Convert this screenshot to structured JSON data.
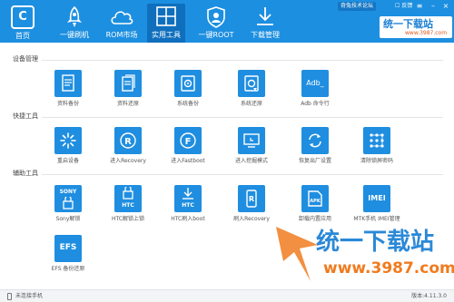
{
  "colors": {
    "topbar": "#1d8fe0",
    "active_tab": "#0f6fbd",
    "tile": "#1f8ee0"
  },
  "app": {
    "logo_label": "首页",
    "logo_icon": "app-logo-icon"
  },
  "nav": [
    {
      "label": "一键刷机",
      "icon": "rocket-icon"
    },
    {
      "label": "ROM市场",
      "icon": "cloud-icon"
    },
    {
      "label": "实用工具",
      "icon": "grid-icon",
      "active": true
    },
    {
      "label": "一键ROOT",
      "icon": "shield-icon"
    },
    {
      "label": "下载管理",
      "icon": "download-icon"
    }
  ],
  "window": {
    "forum": "奇兔技术论坛",
    "feedback": "反馈"
  },
  "brand": {
    "name": "统一下载站",
    "url": "www.3987.com"
  },
  "sections": {
    "device": "设备管理",
    "quick": "快捷工具",
    "aux": "辅助工具"
  },
  "device_tools": [
    {
      "label": "资料备份",
      "icon": "backup-doc-icon"
    },
    {
      "label": "资料还原",
      "icon": "restore-doc-icon"
    },
    {
      "label": "系统备份",
      "icon": "system-backup-icon"
    },
    {
      "label": "系统还原",
      "icon": "system-restore-icon"
    },
    {
      "label": "Adb 命令行",
      "icon": "adb-terminal-icon",
      "tile_text": "Adb_"
    }
  ],
  "quick_tools": [
    {
      "label": "重启设备",
      "icon": "restart-icon"
    },
    {
      "label": "进入Recovery",
      "icon": "recovery-icon",
      "tile_text": "R"
    },
    {
      "label": "进入Fastboot",
      "icon": "fastboot-icon",
      "tile_text": "F"
    },
    {
      "label": "进入挖掘模式",
      "icon": "dig-mode-icon"
    },
    {
      "label": "恢复出厂设置",
      "icon": "factory-reset-icon"
    },
    {
      "label": "清除锁屏密码",
      "icon": "pattern-lock-icon"
    }
  ],
  "aux_tools": [
    {
      "label": "Sony解锁",
      "icon": "sony-unlock-icon",
      "tile_text": "SONY"
    },
    {
      "label": "HTC解锁上锁",
      "icon": "htc-unlock-icon",
      "tile_text": "HTC"
    },
    {
      "label": "HTC刷入boot",
      "icon": "htc-boot-icon",
      "tile_text": "HTC"
    },
    {
      "label": "刷入Recovery",
      "icon": "flash-recovery-icon",
      "tile_text": "R"
    },
    {
      "label": "卸载内置应用",
      "icon": "uninstall-apk-icon",
      "tile_text": "APK"
    },
    {
      "label": "MTK手机 IMEI管理",
      "icon": "imei-icon",
      "tile_text": "IMEI"
    },
    {
      "label": "EFS 备份还原",
      "icon": "efs-icon",
      "tile_text": "EFS"
    }
  ],
  "status": {
    "text": "未连接手机",
    "version": "版本:4.11.3.0"
  },
  "watermark": {
    "text": "统一下载站",
    "url": "www.3987.com"
  }
}
